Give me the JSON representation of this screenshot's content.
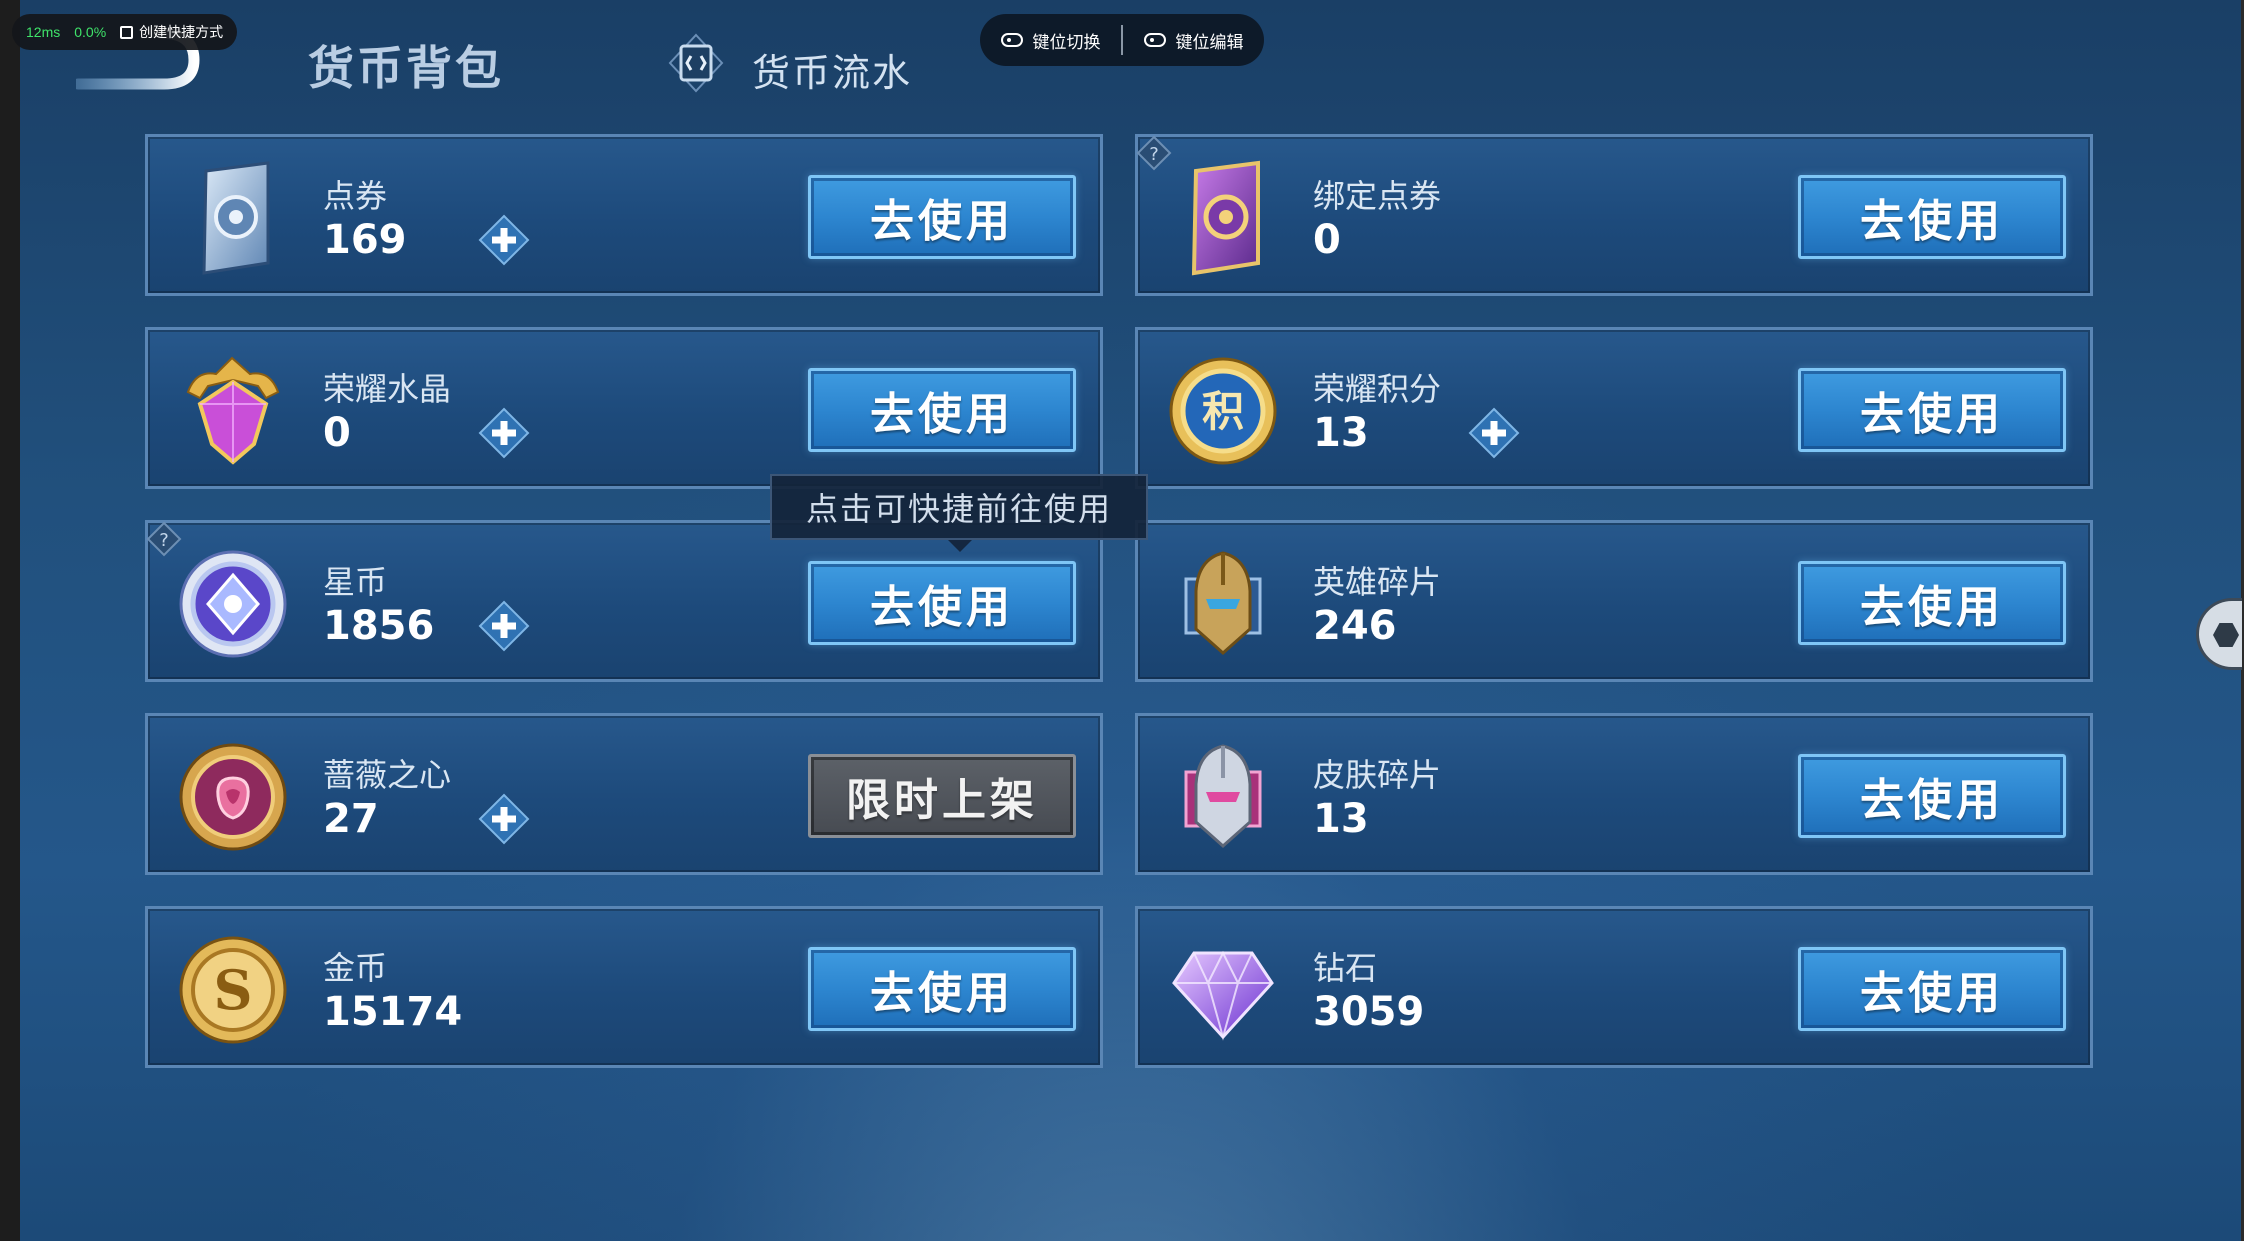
{
  "overlay": {
    "latency": "12ms",
    "usage": "0.0%",
    "shortcut_label": "创建快捷方式"
  },
  "controls": {
    "switch_label": "键位切换",
    "edit_label": "键位编辑"
  },
  "header": {
    "title": "货币背包",
    "tab_flow": "货币流水"
  },
  "tooltip": "点击可快捷前往使用",
  "cards": [
    {
      "name": "点券",
      "amount": "169",
      "button": "去使用",
      "icon": "voucher-card-icon"
    },
    {
      "name": "绑定点券",
      "amount": "0",
      "button": "去使用",
      "icon": "bound-voucher-card-icon"
    },
    {
      "name": "荣耀水晶",
      "amount": "0",
      "button": "去使用",
      "icon": "glory-crystal-icon"
    },
    {
      "name": "荣耀积分",
      "amount": "13",
      "button": "去使用",
      "icon": "glory-points-icon",
      "badge_char": "积"
    },
    {
      "name": "星币",
      "amount": "1856",
      "button": "去使用",
      "icon": "star-coin-icon"
    },
    {
      "name": "英雄碎片",
      "amount": "246",
      "button": "去使用",
      "icon": "hero-fragment-icon"
    },
    {
      "name": "蔷薇之心",
      "amount": "27",
      "button": "限时上架",
      "icon": "rose-heart-icon"
    },
    {
      "name": "皮肤碎片",
      "amount": "13",
      "button": "去使用",
      "icon": "skin-fragment-icon"
    },
    {
      "name": "金币",
      "amount": "15174",
      "button": "去使用",
      "icon": "gold-coin-icon",
      "badge_char": "S"
    },
    {
      "name": "钻石",
      "amount": "3059",
      "button": "去使用",
      "icon": "diamond-icon"
    }
  ],
  "colors": {
    "background": "#21507d",
    "card": "#1d4a7b",
    "button": "#2d86d0",
    "button_border": "#7fc6f6",
    "limited_button": "#474b52"
  }
}
